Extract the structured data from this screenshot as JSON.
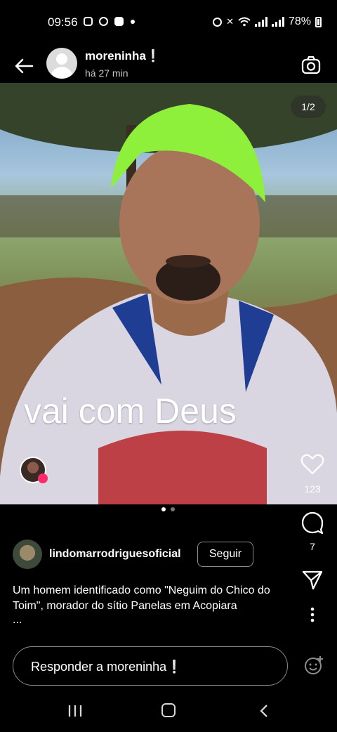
{
  "status_bar": {
    "time": "09:56",
    "battery": "78%",
    "icons": [
      "instagram-icon",
      "whatsapp-icon",
      "app-icon",
      "alarm-icon",
      "mute-icon",
      "wifi-icon",
      "signal-icon",
      "battery-icon"
    ]
  },
  "header": {
    "username": "moreninha❕",
    "time_ago": "há 27 min",
    "back_icon": "arrow-left-icon",
    "camera_icon": "camera-icon"
  },
  "media": {
    "page_counter": "1/2",
    "overlay_text": "vai com Deus",
    "carousel_total": 2,
    "carousel_active": 1
  },
  "actions": {
    "likes": "123",
    "comments": "7"
  },
  "post": {
    "author": "lindomarrodriguesoficial",
    "follow_label": "Seguir",
    "description": "Um homem identificado como \"Neguim do Chico do Toim\", morador do sítio Panelas em Acopiara",
    "more": "..."
  },
  "reply": {
    "placeholder": "Responder a moreninha❕"
  },
  "colors": {
    "background": "#000000",
    "text": "#ffffff",
    "like_badge": "#ff2a6d"
  }
}
